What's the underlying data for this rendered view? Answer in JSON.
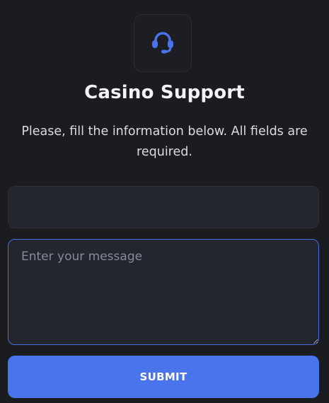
{
  "header": {
    "icon": "headset-icon",
    "title": "Casino Support",
    "subtitle": "Please, fill the information below. All fields are required."
  },
  "form": {
    "name_field": {
      "value": "",
      "placeholder": ""
    },
    "message_field": {
      "value": "",
      "placeholder": "Enter your message"
    },
    "submit_label": "SUBMIT"
  },
  "colors": {
    "background": "#1b1c20",
    "field_background": "#23252f",
    "accent": "#4a74ec",
    "focus_border": "#4a6de3"
  }
}
